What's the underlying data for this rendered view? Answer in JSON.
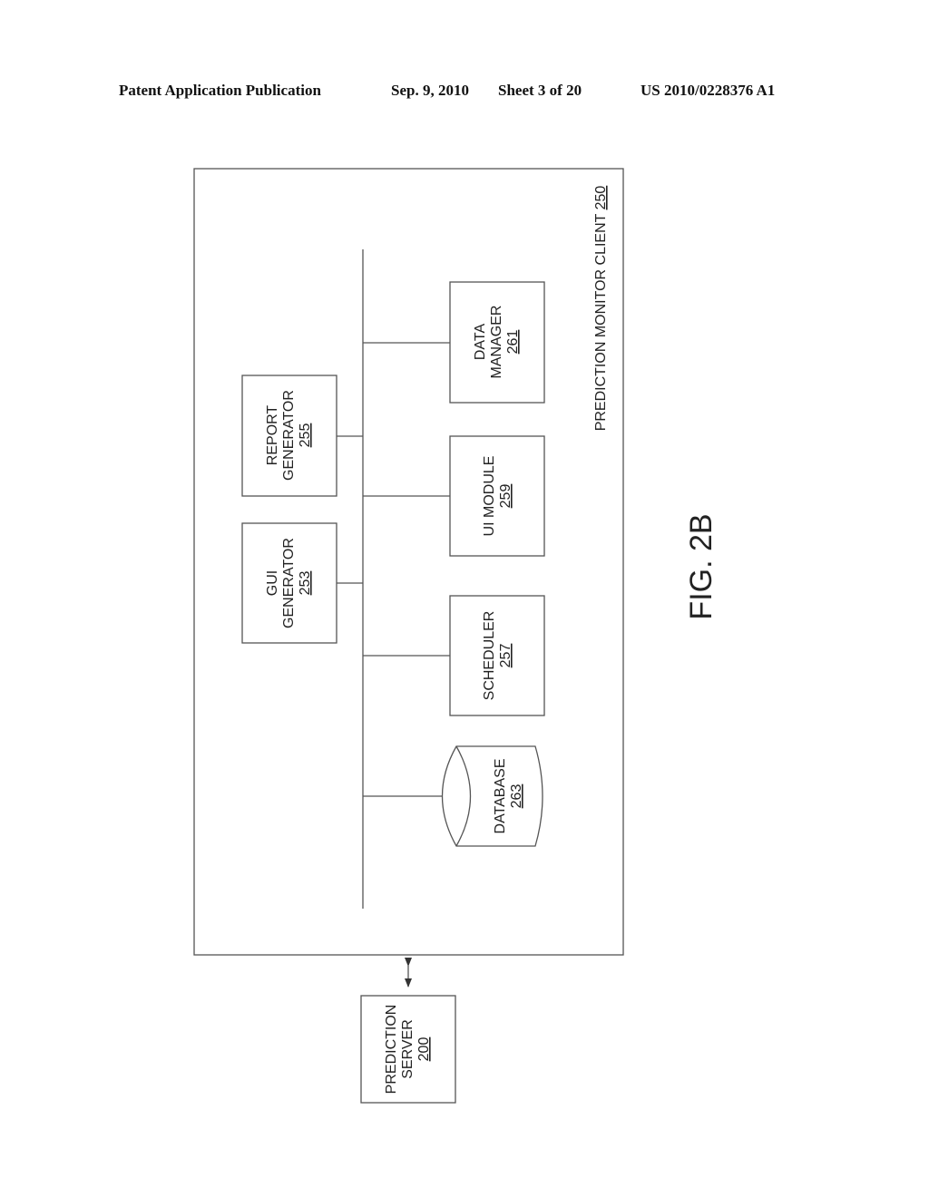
{
  "header": {
    "publication": "Patent Application Publication",
    "date": "Sep. 9, 2010",
    "sheet": "Sheet 3 of 20",
    "number": "US 2010/0228376 A1"
  },
  "figure": {
    "label": "FIG. 2B",
    "client": {
      "name": "PREDICTION MONITOR CLIENT",
      "ref": "250"
    },
    "server": {
      "line1": "PREDICTION",
      "line2": "SERVER",
      "ref": "200"
    },
    "components": {
      "report_generator": {
        "line1": "REPORT",
        "line2": "GENERATOR",
        "ref": "255"
      },
      "gui_generator": {
        "line1": "GUI",
        "line2": "GENERATOR",
        "ref": "253"
      },
      "data_manager": {
        "line1": "DATA",
        "line2": "MANAGER",
        "ref": "261"
      },
      "ui_module": {
        "line1": "UI MODULE",
        "ref": "259"
      },
      "scheduler": {
        "line1": "SCHEDULER",
        "ref": "257"
      },
      "database": {
        "line1": "DATABASE",
        "ref": "263"
      }
    }
  }
}
